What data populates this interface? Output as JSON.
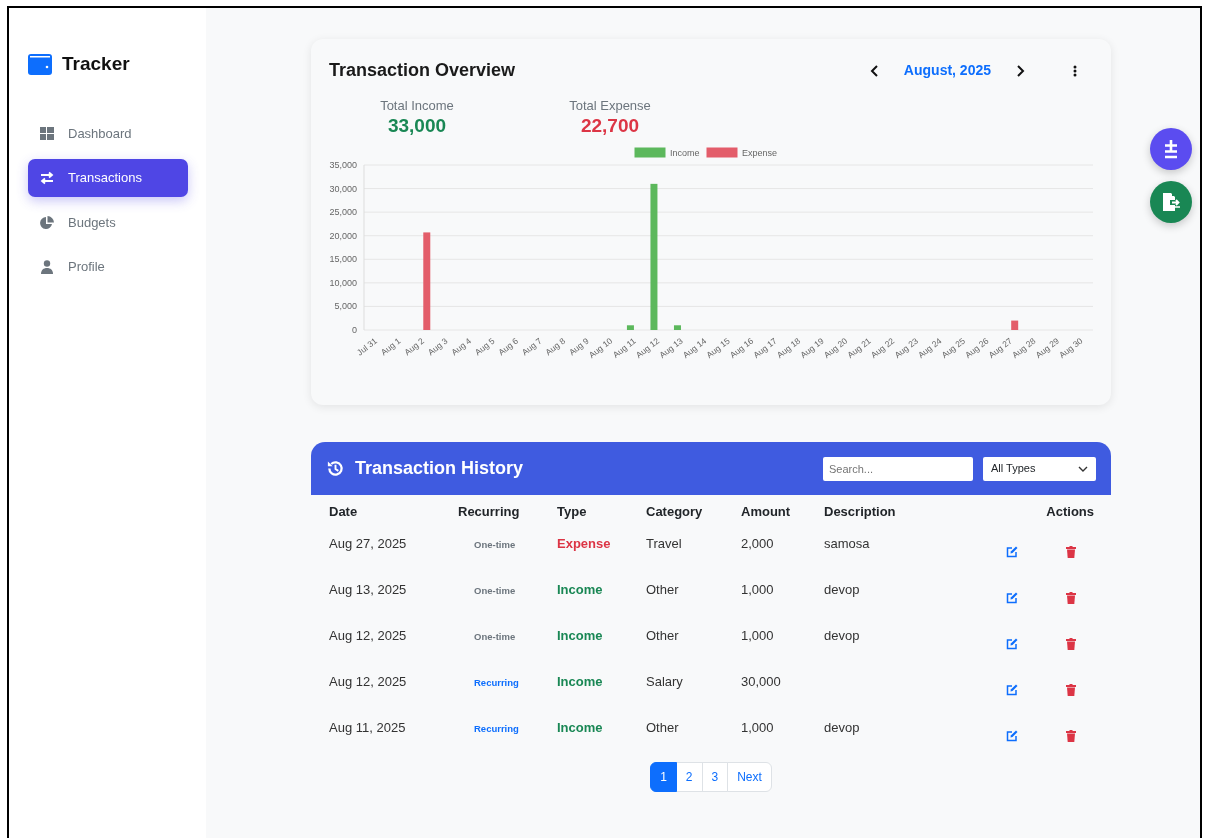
{
  "sidebar": {
    "brand": "Tracker",
    "items": [
      {
        "label": "Dashboard",
        "selected": false
      },
      {
        "label": "Transactions",
        "selected": true
      },
      {
        "label": "Budgets",
        "selected": false
      },
      {
        "label": "Profile",
        "selected": false
      }
    ]
  },
  "overview": {
    "title": "Transaction Overview",
    "month": "August, 2025",
    "totals": [
      {
        "label": "Total Income",
        "value": "33,000",
        "kind": "income"
      },
      {
        "label": "Total Expense",
        "value": "22,700",
        "kind": "expense"
      }
    ],
    "chart_data": {
      "type": "bar",
      "categories": [
        "Jul 31",
        "Aug 1",
        "Aug 2",
        "Aug 3",
        "Aug 4",
        "Aug 5",
        "Aug 6",
        "Aug 7",
        "Aug 8",
        "Aug 9",
        "Aug 10",
        "Aug 11",
        "Aug 12",
        "Aug 13",
        "Aug 14",
        "Aug 15",
        "Aug 16",
        "Aug 17",
        "Aug 18",
        "Aug 19",
        "Aug 20",
        "Aug 21",
        "Aug 22",
        "Aug 23",
        "Aug 24",
        "Aug 25",
        "Aug 26",
        "Aug 27",
        "Aug 28",
        "Aug 29",
        "Aug 30"
      ],
      "series": [
        {
          "name": "Income",
          "color": "#5cb85c",
          "values": [
            0,
            0,
            0,
            0,
            0,
            0,
            0,
            0,
            0,
            0,
            0,
            1000,
            31000,
            1000,
            0,
            0,
            0,
            0,
            0,
            0,
            0,
            0,
            0,
            0,
            0,
            0,
            0,
            0,
            0,
            0,
            0
          ]
        },
        {
          "name": "Expense",
          "color": "#e35d6a",
          "values": [
            0,
            0,
            20700,
            0,
            0,
            0,
            0,
            0,
            0,
            0,
            0,
            0,
            0,
            0,
            0,
            0,
            0,
            0,
            0,
            0,
            0,
            0,
            0,
            0,
            0,
            0,
            0,
            2000,
            0,
            0,
            0
          ]
        }
      ],
      "ylim": [
        0,
        35000
      ],
      "grid": true,
      "legend": true,
      "yticks": [
        {
          "value": 0,
          "label": "0"
        },
        {
          "value": 5000,
          "label": "5,000"
        },
        {
          "value": 10000,
          "label": "10,000"
        },
        {
          "value": 15000,
          "label": "15,000"
        },
        {
          "value": 20000,
          "label": "20,000"
        },
        {
          "value": 25000,
          "label": "25,000"
        },
        {
          "value": 30000,
          "label": "30,000"
        },
        {
          "value": 35000,
          "label": "35,000"
        }
      ]
    }
  },
  "history": {
    "title": "Transaction History",
    "search": {
      "placeholder": "Search..."
    },
    "filter": "All Types",
    "columns": [
      "Date",
      "Recurring",
      "Type",
      "Category",
      "Amount",
      "Description",
      "Actions"
    ],
    "rows": [
      {
        "date": "Aug 27, 2025",
        "recurring": {
          "text": "One-time",
          "kind": "one-time"
        },
        "type": {
          "text": "Expense",
          "kind": "expense"
        },
        "category": "Travel",
        "amount": "2,000",
        "description": "samosa"
      },
      {
        "date": "Aug 13, 2025",
        "recurring": {
          "text": "One-time",
          "kind": "one-time"
        },
        "type": {
          "text": "Income",
          "kind": "income"
        },
        "category": "Other",
        "amount": "1,000",
        "description": "devop"
      },
      {
        "date": "Aug 12, 2025",
        "recurring": {
          "text": "One-time",
          "kind": "one-time"
        },
        "type": {
          "text": "Income",
          "kind": "income"
        },
        "category": "Other",
        "amount": "1,000",
        "description": "devop"
      },
      {
        "date": "Aug 12, 2025",
        "recurring": {
          "text": "Recurring",
          "kind": "recurring"
        },
        "type": {
          "text": "Income",
          "kind": "income"
        },
        "category": "Salary",
        "amount": "30,000"
      },
      {
        "date": "Aug 11, 2025",
        "recurring": {
          "text": "Recurring",
          "kind": "recurring"
        },
        "type": {
          "text": "Income",
          "kind": "income"
        },
        "category": "Other",
        "amount": "1,000",
        "description": "devop"
      }
    ],
    "pagination": [
      {
        "label": "1",
        "selected": true
      },
      {
        "label": "2",
        "selected": false
      },
      {
        "label": "3",
        "selected": false
      },
      {
        "label": "Next",
        "selected": false
      }
    ]
  }
}
